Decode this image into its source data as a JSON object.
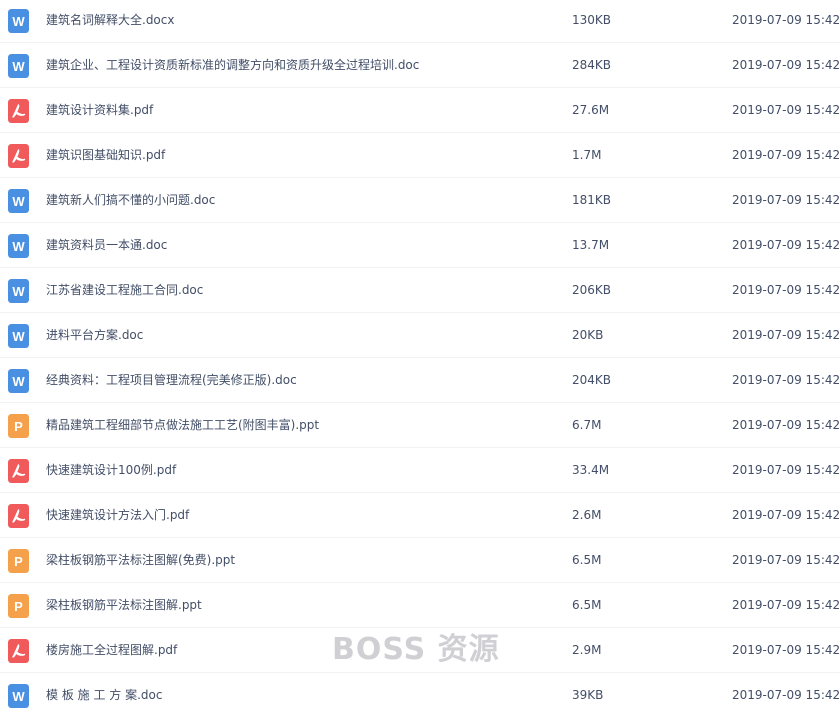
{
  "files": [
    {
      "type": "word",
      "name": "建筑名词解释大全.docx",
      "size": "130KB",
      "date": "2019-07-09 15:42"
    },
    {
      "type": "word",
      "name": "建筑企业、工程设计资质新标准的调整方向和资质升级全过程培训.doc",
      "size": "284KB",
      "date": "2019-07-09 15:42"
    },
    {
      "type": "pdf",
      "name": "建筑设计资料集.pdf",
      "size": "27.6M",
      "date": "2019-07-09 15:42"
    },
    {
      "type": "pdf",
      "name": "建筑识图基础知识.pdf",
      "size": "1.7M",
      "date": "2019-07-09 15:42"
    },
    {
      "type": "word",
      "name": "建筑新人们搞不懂的小问题.doc",
      "size": "181KB",
      "date": "2019-07-09 15:42"
    },
    {
      "type": "word",
      "name": "建筑资料员一本通.doc",
      "size": "13.7M",
      "date": "2019-07-09 15:42"
    },
    {
      "type": "word",
      "name": "江苏省建设工程施工合同.doc",
      "size": "206KB",
      "date": "2019-07-09 15:42"
    },
    {
      "type": "word",
      "name": "进料平台方案.doc",
      "size": "20KB",
      "date": "2019-07-09 15:42"
    },
    {
      "type": "word",
      "name": "经典资料：工程项目管理流程(完美修正版).doc",
      "size": "204KB",
      "date": "2019-07-09 15:42"
    },
    {
      "type": "ppt",
      "name": "精品建筑工程细部节点做法施工工艺(附图丰富).ppt",
      "size": "6.7M",
      "date": "2019-07-09 15:42"
    },
    {
      "type": "pdf",
      "name": "快速建筑设计100例.pdf",
      "size": "33.4M",
      "date": "2019-07-09 15:42"
    },
    {
      "type": "pdf",
      "name": "快速建筑设计方法入门.pdf",
      "size": "2.6M",
      "date": "2019-07-09 15:42"
    },
    {
      "type": "ppt",
      "name": "梁柱板钢筋平法标注图解(免费).ppt",
      "size": "6.5M",
      "date": "2019-07-09 15:42"
    },
    {
      "type": "ppt",
      "name": "梁柱板钢筋平法标注图解.ppt",
      "size": "6.5M",
      "date": "2019-07-09 15:42"
    },
    {
      "type": "pdf",
      "name": "楼房施工全过程图解.pdf",
      "size": "2.9M",
      "date": "2019-07-09 15:42"
    },
    {
      "type": "word",
      "name": "模 板 施 工 方 案.doc",
      "size": "39KB",
      "date": "2019-07-09 15:42"
    }
  ],
  "icons": {
    "word": {
      "color": "#4a90e2",
      "letter": "W",
      "icon_name": "word-doc-icon"
    },
    "pdf": {
      "color": "#f05a5a",
      "letter": "",
      "icon_name": "pdf-icon"
    },
    "ppt": {
      "color": "#f5a14b",
      "letter": "P",
      "icon_name": "ppt-icon"
    }
  },
  "watermark": "BOSS 资源"
}
